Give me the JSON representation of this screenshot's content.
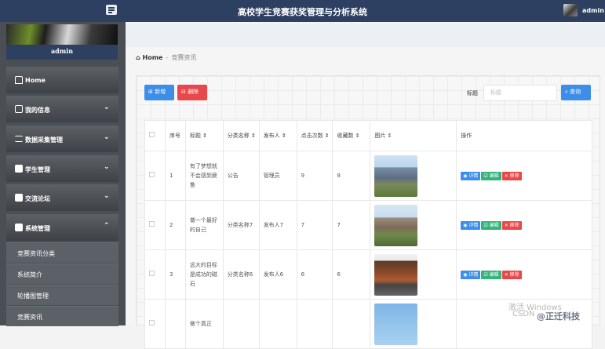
{
  "header": {
    "title": "高校学生竞赛获奖管理与分析系统",
    "user": "admin"
  },
  "sidebar": {
    "admin_label": "admin",
    "items": [
      {
        "label": "Home",
        "icon": "home-icon"
      },
      {
        "label": "我的信息",
        "icon": "card-icon"
      },
      {
        "label": "数据采集管理",
        "icon": "sliders-icon"
      },
      {
        "label": "学生管理",
        "icon": "grid-icon"
      },
      {
        "label": "交流论坛",
        "icon": "clipboard-icon"
      },
      {
        "label": "系统管理",
        "icon": "settings-icon"
      }
    ],
    "sub_items": [
      "竞赛资讯分类",
      "系统简介",
      "轮播图管理",
      "竞赛资讯"
    ]
  },
  "breadcrumb": {
    "home": "Home",
    "current": "竞赛资讯"
  },
  "toolbar": {
    "add_label": "新增",
    "delete_label": "删除",
    "search_label": "标题",
    "search_placeholder": "标题",
    "search_button": "查询"
  },
  "table": {
    "headers": [
      "序号",
      "标题 ⇕",
      "分类名称 ⇕",
      "发布人 ⇕",
      "点击次数 ⇕",
      "收藏数 ⇕",
      "图片 ⇕",
      "操作"
    ],
    "rows": [
      {
        "index": "1",
        "title": "有了梦想就不会感到疲惫",
        "category": "公告",
        "publisher": "管理员",
        "clicks": "9",
        "favorites": "8"
      },
      {
        "index": "2",
        "title": "做一个最好的自己",
        "category": "分类名称7",
        "publisher": "发布人7",
        "clicks": "7",
        "favorites": "7"
      },
      {
        "index": "3",
        "title": "远大的目标是成功的磁石",
        "category": "分类名称6",
        "publisher": "发布人6",
        "clicks": "6",
        "favorites": "6"
      },
      {
        "index": "",
        "title": "做个真正",
        "category": "",
        "publisher": "",
        "clicks": "",
        "favorites": ""
      }
    ],
    "ops": {
      "detail": "详情",
      "edit": "编辑",
      "remove": "移除"
    }
  },
  "watermark": {
    "line1": "激活 Windows",
    "line2": "CSDN",
    "brand": "@正迁科技"
  }
}
